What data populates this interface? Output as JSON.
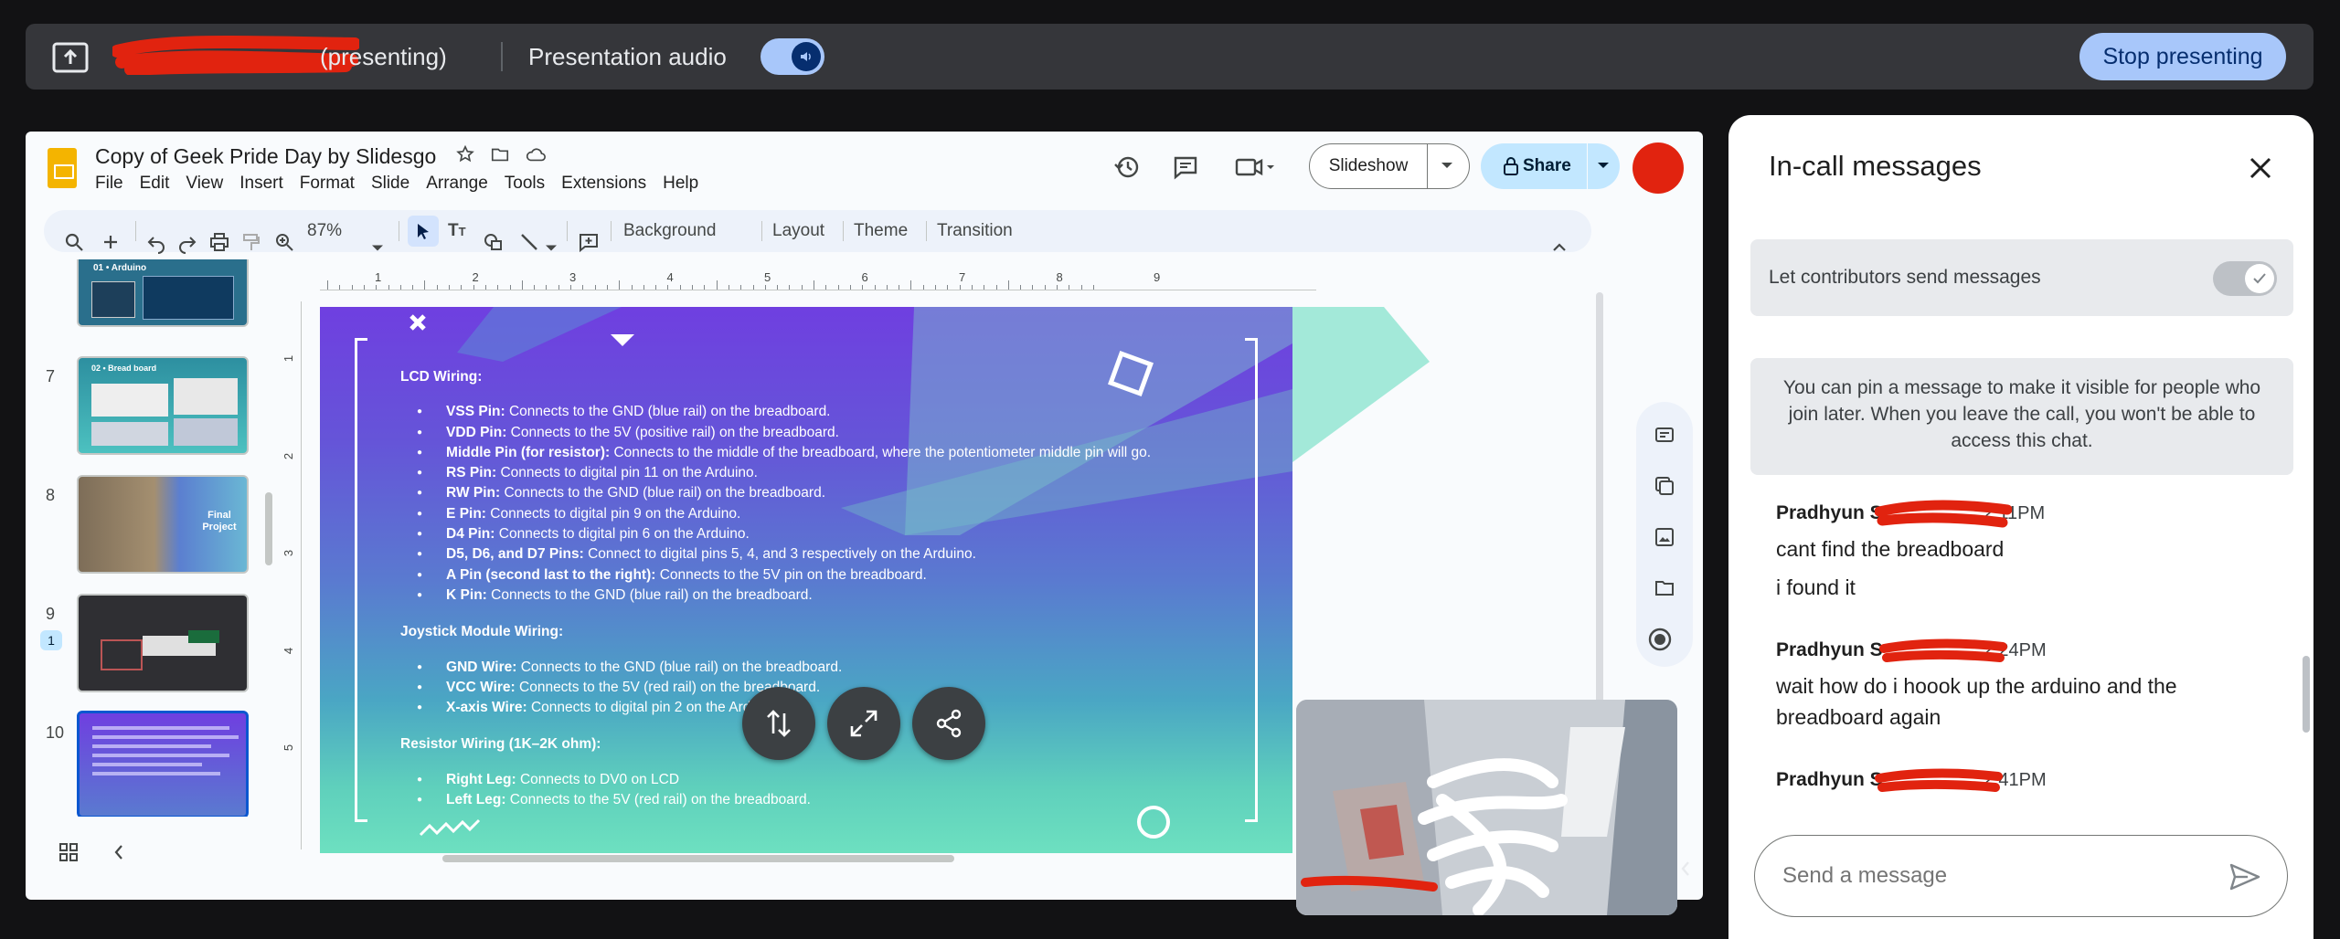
{
  "present_bar": {
    "label": "(presenting)",
    "audio_label": "Presentation audio",
    "stop_label": "Stop presenting"
  },
  "slides_app": {
    "doc_title": "Copy of Geek Pride Day by Slidesgo",
    "menu": [
      "File",
      "Edit",
      "View",
      "Insert",
      "Format",
      "Slide",
      "Arrange",
      "Tools",
      "Extensions",
      "Help"
    ],
    "slideshow_label": "Slideshow",
    "share_label": "Share",
    "toolbar": {
      "zoom": "87%",
      "background": "Background",
      "layout": "Layout",
      "theme": "Theme",
      "transition": "Transition"
    },
    "ruler_h": [
      "1",
      "2",
      "3",
      "4",
      "5",
      "6",
      "7",
      "8",
      "9"
    ],
    "ruler_v": [
      "1",
      "2",
      "3",
      "4",
      "5"
    ],
    "filmstrip": [
      {
        "num": "",
        "title": "01 • Arduino"
      },
      {
        "num": "7",
        "title": "02 • Bread board"
      },
      {
        "num": "8",
        "title": "Final Project"
      },
      {
        "num": "9",
        "badge": "1"
      },
      {
        "num": "10"
      }
    ],
    "slide": {
      "lcd_heading": "LCD Wiring:",
      "lcd_items": [
        {
          "b": "VSS Pin:",
          "t": " Connects to the GND (blue rail) on the breadboard."
        },
        {
          "b": "VDD Pin:",
          "t": " Connects to the 5V (positive rail) on the breadboard."
        },
        {
          "b": "Middle Pin (for resistor):",
          "t": " Connects to the middle of the breadboard, where the potentiometer middle pin will go."
        },
        {
          "b": "RS Pin:",
          "t": " Connects to digital pin 11 on the Arduino."
        },
        {
          "b": "RW Pin:",
          "t": " Connects to the GND (blue rail) on the breadboard."
        },
        {
          "b": "E Pin:",
          "t": " Connects to digital pin 9 on the Arduino."
        },
        {
          "b": "D4 Pin:",
          "t": " Connects to digital pin 6 on the Arduino."
        },
        {
          "b": "D5, D6, and D7 Pins:",
          "t": " Connect to digital pins 5, 4, and 3 respectively on the Arduino."
        },
        {
          "b": "A Pin (second last to the right):",
          "t": " Connects to the 5V pin on the breadboard."
        },
        {
          "b": "K Pin:",
          "t": " Connects to the GND (blue rail) on the breadboard."
        }
      ],
      "joystick_heading": "Joystick Module Wiring:",
      "joystick_items": [
        {
          "b": "GND Wire:",
          "t": " Connects to the GND (blue rail) on the breadboard."
        },
        {
          "b": "VCC Wire:",
          "t": " Connects to the 5V (red rail) on the breadboard."
        },
        {
          "b": "X-axis Wire:",
          "t": " Connects to digital pin 2 on the Arduino."
        }
      ],
      "resistor_heading": "Resistor Wiring (1K–2K ohm):",
      "resistor_items": [
        {
          "b": "Right Leg:",
          "t": " Connects to DV0 on LCD"
        },
        {
          "b": "Left Leg:",
          "t": " Connects to the 5V (red rail) on the breadboard."
        }
      ]
    }
  },
  "chat": {
    "title": "In-call messages",
    "contrib_label": "Let contributors send messages",
    "pin_notice": "You can pin a message to make it visible for people who join later. When you leave the call, you won't be able to access this chat.",
    "messages": [
      {
        "sender": "Pradhyun S",
        "time": "2:11PM",
        "lines": [
          "cant find the breadboard",
          "i found it"
        ]
      },
      {
        "sender": "Pradhyun S",
        "time": "2:24PM",
        "lines": [
          "wait how do i hoook up the arduino and the breadboard again"
        ]
      },
      {
        "sender": "Pradhyun S",
        "time": "2:41PM",
        "lines": []
      }
    ],
    "input_placeholder": "Send a message"
  },
  "colors": {
    "accent": "#a8c7fa",
    "share_bg": "#c2e7ff",
    "redaction": "#e1230f"
  }
}
